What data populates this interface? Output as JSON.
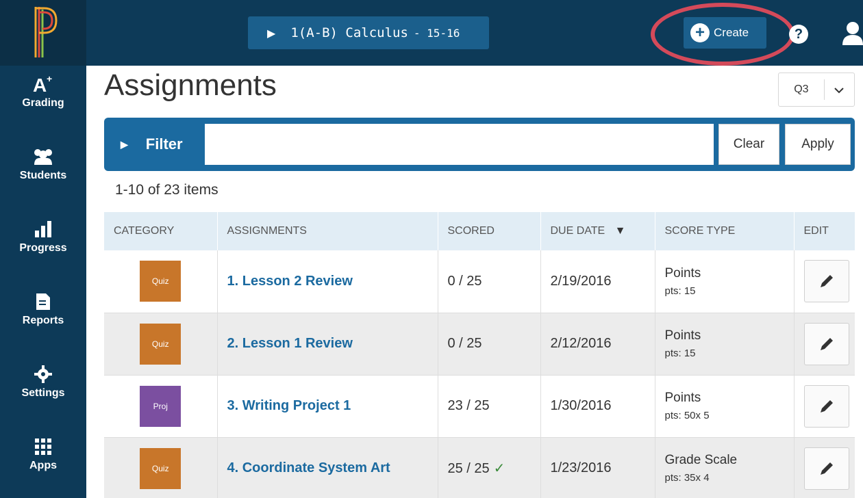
{
  "header": {
    "class_name": "1(A-B) Calculus",
    "class_term": "- 15-16",
    "create_label": "Create"
  },
  "sidebar": {
    "items": [
      {
        "label": "Grading",
        "icon": "grading-icon"
      },
      {
        "label": "Students",
        "icon": "students-icon"
      },
      {
        "label": "Progress",
        "icon": "progress-icon"
      },
      {
        "label": "Reports",
        "icon": "reports-icon"
      },
      {
        "label": "Settings",
        "icon": "gear-icon"
      },
      {
        "label": "Apps",
        "icon": "apps-grid-icon"
      }
    ]
  },
  "page": {
    "title": "Assignments",
    "term": "Q3"
  },
  "filter": {
    "label": "Filter",
    "value": "",
    "clear_label": "Clear",
    "apply_label": "Apply"
  },
  "list": {
    "count_text": "1-10 of 23 items",
    "columns": [
      "CATEGORY",
      "ASSIGNMENTS",
      "SCORED",
      "DUE DATE",
      "SCORE TYPE",
      "EDIT"
    ],
    "sort_indicator": "▼",
    "rows": [
      {
        "category": "Quiz",
        "category_color": "#c8762a",
        "name": "1. Lesson 2 Review",
        "scored": "0 / 25",
        "complete": false,
        "due": "2/19/2016",
        "score_type": "Points",
        "pts": "pts: 15"
      },
      {
        "category": "Quiz",
        "category_color": "#c8762a",
        "name": "2. Lesson 1 Review",
        "scored": "0 / 25",
        "complete": false,
        "due": "2/12/2016",
        "score_type": "Points",
        "pts": "pts: 15"
      },
      {
        "category": "Proj",
        "category_color": "#7b4fa0",
        "name": "3. Writing Project 1",
        "scored": "23 / 25",
        "complete": false,
        "due": "1/30/2016",
        "score_type": "Points",
        "pts": "pts: 50x 5"
      },
      {
        "category": "Quiz",
        "category_color": "#c8762a",
        "name": "4. Coordinate System Art",
        "scored": "25 / 25",
        "complete": true,
        "due": "1/23/2016",
        "score_type": "Grade Scale",
        "pts": "pts: 35x 4"
      }
    ]
  },
  "colors": {
    "nav_bg": "#0d3a58",
    "accent": "#1b6aa0",
    "highlight_ring": "#d44a5a",
    "check": "#3a8a3a"
  }
}
